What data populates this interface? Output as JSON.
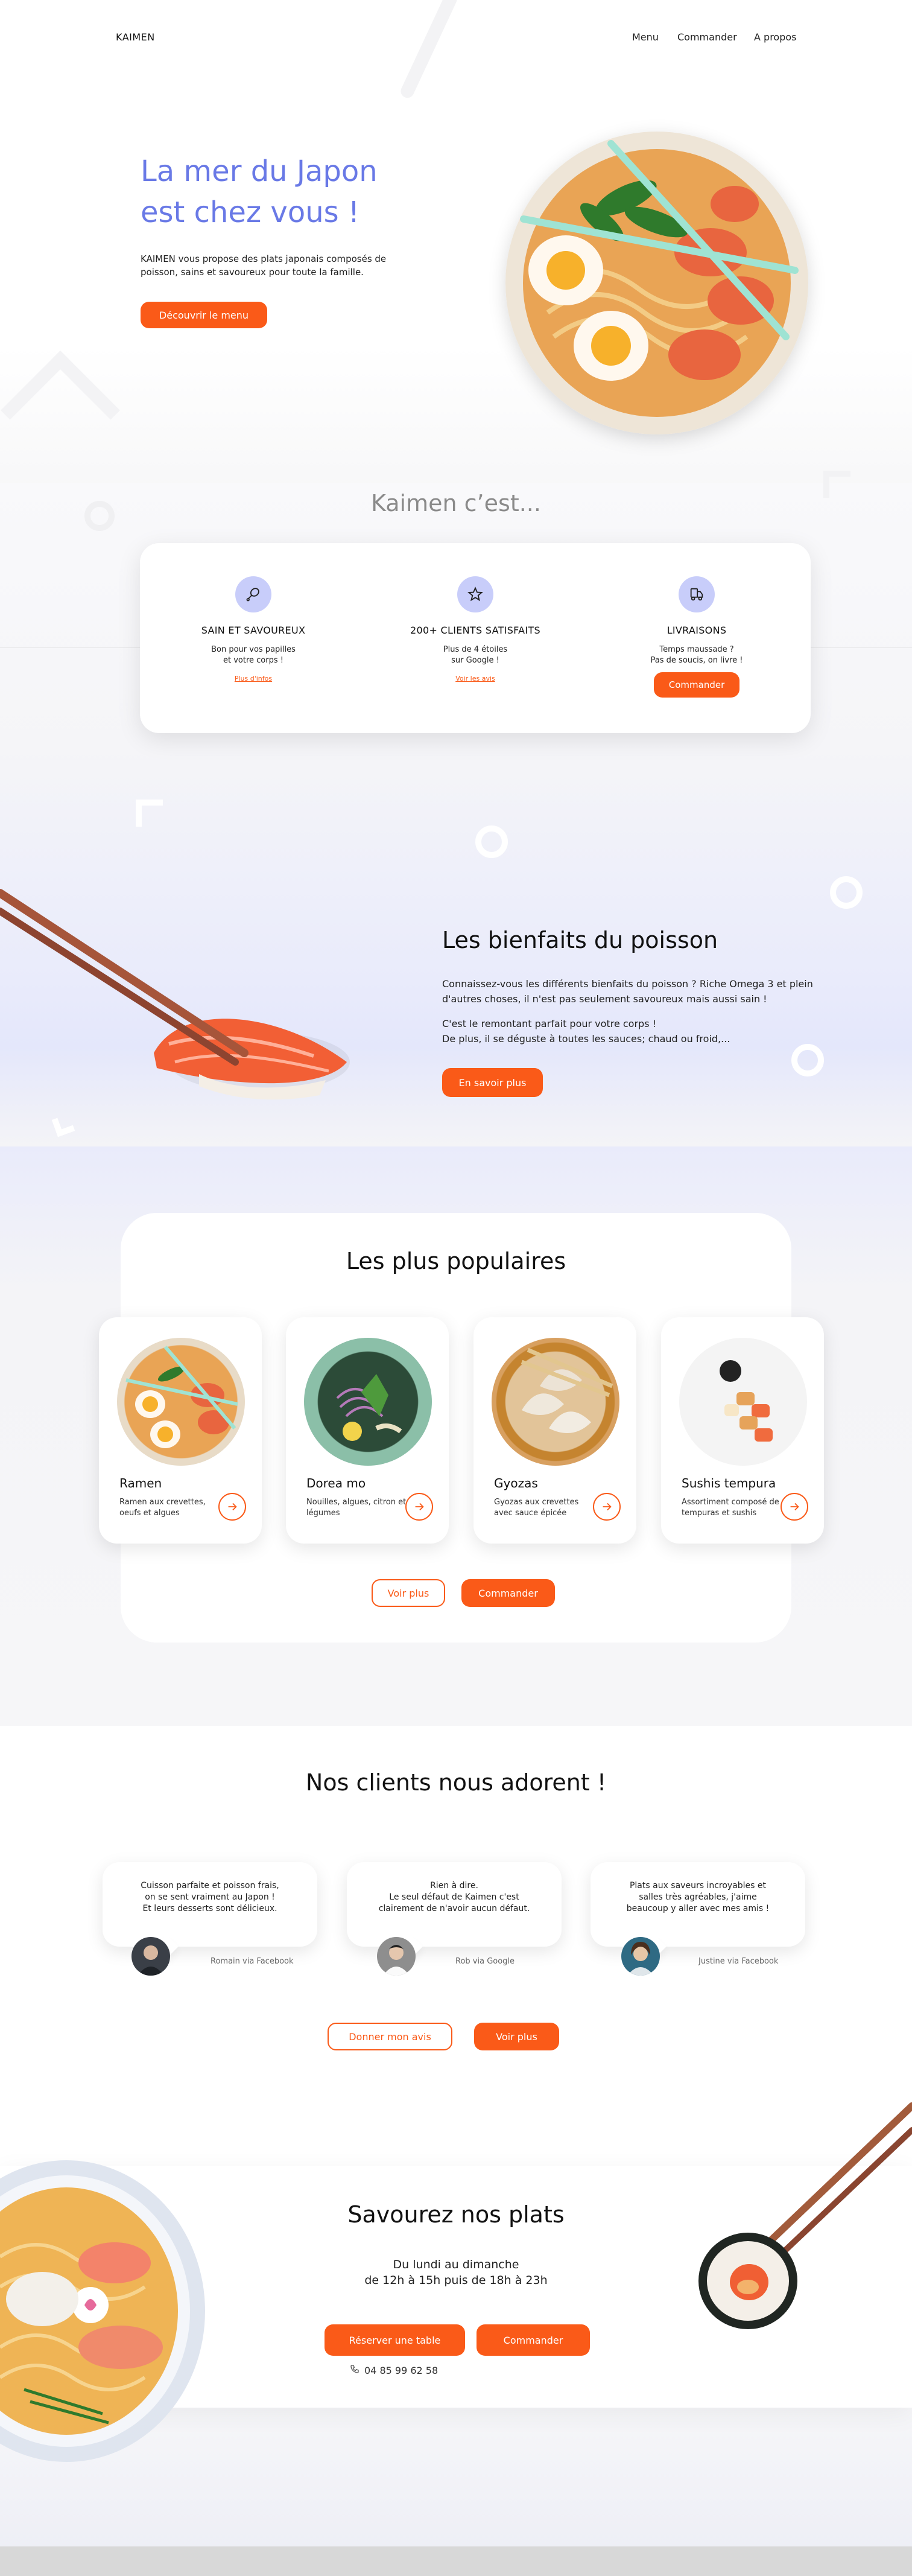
{
  "nav": {
    "logo": "KAIMEN",
    "links": [
      "Menu",
      "Commander",
      "A propos"
    ]
  },
  "hero": {
    "title_line1": "La mer du Japon",
    "title_line2": "est chez vous !",
    "text": "KAIMEN vous propose des plats japonais composés de poisson, sains et savoureux pour toute la famille.",
    "cta": "Découvrir le menu"
  },
  "features": {
    "title": "Kaimen c’est...",
    "items": [
      {
        "icon": "drumstick-icon",
        "title": "SAIN ET SAVOUREUX",
        "desc_line1": "Bon pour vos papilles",
        "desc_line2": "et votre corps !",
        "link": "Plus d'infos"
      },
      {
        "icon": "star-icon",
        "title": "200+ CLIENTS SATISFAITS",
        "desc_line1": "Plus de 4 étoiles",
        "desc_line2": "sur Google !",
        "link": "Voir les avis"
      },
      {
        "icon": "delivery-icon",
        "title": "LIVRAISONS",
        "desc_line1": "Temps maussade ?",
        "desc_line2": "Pas de soucis, on livre !",
        "button": "Commander"
      }
    ]
  },
  "benefits": {
    "title": "Les bienfaits du poisson",
    "para1": "Connaissez-vous les différents bienfaits du poisson ? Riche Omega 3 et plein d'autres choses, il n'est pas seulement savoureux mais aussi sain !",
    "para2_line1": "C'est le remontant parfait pour votre corps !",
    "para2_line2": "De plus, il se déguste à toutes les sauces; chaud ou froid,...",
    "cta": "En savoir plus"
  },
  "popular": {
    "title": "Les plus populaires",
    "dishes": [
      {
        "name": "Ramen",
        "desc": "Ramen aux crevettes, oeufs et algues"
      },
      {
        "name": "Dorea mo",
        "desc": "Nouilles, algues, citron et légumes"
      },
      {
        "name": "Gyozas",
        "desc": "Gyozas aux crevettes avec sauce épicée"
      },
      {
        "name": "Sushis tempura",
        "desc": "Assortiment composé de tempuras et sushis"
      }
    ],
    "more": "Voir plus",
    "order": "Commander"
  },
  "reviews": {
    "title": "Nos clients nous adorent !",
    "items": [
      {
        "line1": "Cuisson parfaite et poisson frais,",
        "line2": "on se sent vraiment au Japon !",
        "line3": "Et leurs desserts sont délicieux.",
        "author": "Romain via Facebook"
      },
      {
        "line1": "Rien à dire.",
        "line2": "Le seul défaut de Kaimen c'est",
        "line3": "clairement de n'avoir aucun défaut.",
        "author": "Rob via Google"
      },
      {
        "line1": "Plats aux saveurs incroyables et",
        "line2": "salles très agréables, j'aime",
        "line3": "beaucoup y aller avec mes amis !",
        "author": "Justine via Facebook"
      }
    ],
    "give": "Donner mon avis",
    "more": "Voir plus"
  },
  "savor": {
    "title": "Savourez nos plats",
    "hours_line1": "Du lundi au dimanche",
    "hours_line2": "de 12h à 15h puis de 18h à 23h",
    "reserve": "Réserver une table",
    "order": "Commander",
    "phone": "04 85 99 62 58"
  },
  "colors": {
    "accent": "#fa5a18",
    "brand_blue": "#6979e6",
    "icon_bg": "#c8cdfa"
  }
}
